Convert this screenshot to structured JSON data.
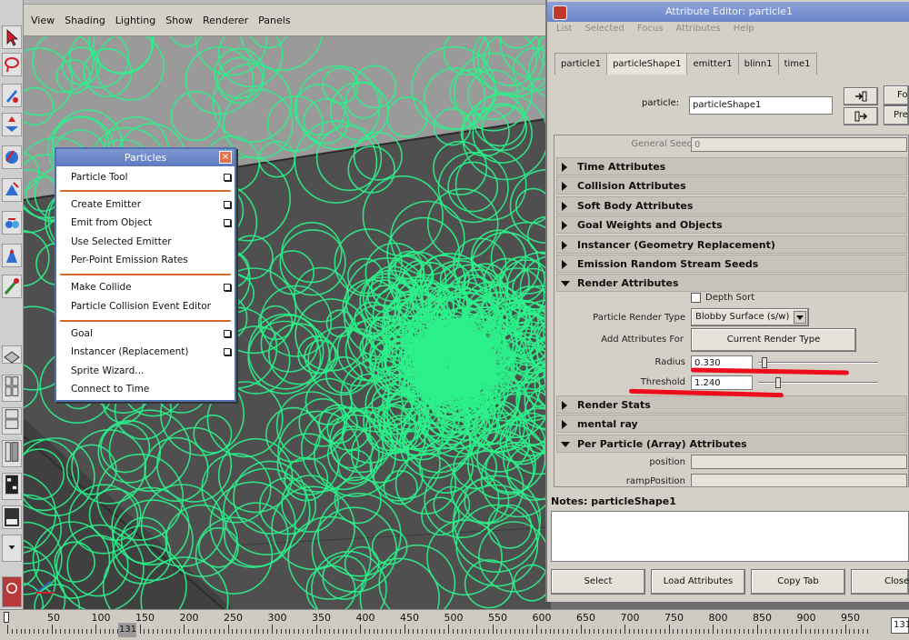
{
  "viewport": {
    "menu": [
      "View",
      "Shading",
      "Lighting",
      "Show",
      "Renderer",
      "Panels"
    ],
    "particle_color": "#2cf08a"
  },
  "particles_menu": {
    "title": "Particles",
    "items": [
      {
        "label": "Particle Tool",
        "option": true
      },
      {
        "label": "Create Emitter",
        "option": true
      },
      {
        "label": "Emit from Object",
        "option": true
      },
      {
        "label": "Use Selected Emitter",
        "option": false
      },
      {
        "label": "Per-Point Emission Rates",
        "option": false
      },
      {
        "label": "Make Collide",
        "option": true
      },
      {
        "label": "Particle Collision Event Editor",
        "option": false
      },
      {
        "label": "Goal",
        "option": true
      },
      {
        "label": "Instancer (Replacement)",
        "option": true
      },
      {
        "label": "Sprite Wizard...",
        "option": false
      },
      {
        "label": "Connect to Time",
        "option": false
      }
    ]
  },
  "attribute_editor": {
    "title": "Attribute Editor: particle1",
    "menu": [
      "List",
      "Selected",
      "Focus",
      "Attributes",
      "Help"
    ],
    "tabs": [
      "particle1",
      "particleShape1",
      "emitter1",
      "blinn1",
      "time1"
    ],
    "node_label": "particle:",
    "node_value": "particleShape1",
    "focus_label": "Fo",
    "presets_label": "Pre",
    "general_seed_label": "General Seed",
    "general_seed_value": "0",
    "sections": [
      {
        "label": "Time Attributes",
        "open": false
      },
      {
        "label": "Collision Attributes",
        "open": false
      },
      {
        "label": "Soft Body Attributes",
        "open": false
      },
      {
        "label": "Goal Weights and Objects",
        "open": false
      },
      {
        "label": "Instancer (Geometry Replacement)",
        "open": false
      },
      {
        "label": "Emission Random Stream Seeds",
        "open": false
      },
      {
        "label": "Render Attributes",
        "open": true
      },
      {
        "label": "Render Stats",
        "open": false
      },
      {
        "label": "mental ray",
        "open": false
      },
      {
        "label": "Per Particle (Array) Attributes",
        "open": true
      }
    ],
    "render": {
      "depth_sort_label": "Depth Sort",
      "render_type_label": "Particle Render Type",
      "render_type_value": "Blobby Surface (s/w)",
      "add_attr_label": "Add Attributes For",
      "add_attr_button": "Current Render Type",
      "radius_label": "Radius",
      "radius_value": "0.330",
      "radius_slider_fraction": 0.03,
      "threshold_label": "Threshold",
      "threshold_value": "1.240",
      "threshold_slider_fraction": 0.15
    },
    "per_particle": {
      "position_label": "position",
      "ramp_position_label": "rampPosition"
    },
    "notes_label": "Notes:  particleShape1",
    "buttons": [
      "Select",
      "Load Attributes",
      "Copy Tab",
      "Close"
    ]
  },
  "timeline": {
    "ticks": [
      "50",
      "100",
      "150",
      "200",
      "250",
      "300",
      "350",
      "400",
      "450",
      "500",
      "550",
      "600",
      "650",
      "700",
      "750",
      "800",
      "850",
      "900",
      "950"
    ],
    "current_frame": "131",
    "end_frame": "131"
  }
}
